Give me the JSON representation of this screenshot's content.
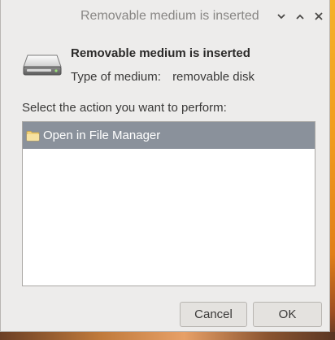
{
  "window": {
    "title": "Removable medium is inserted"
  },
  "header": {
    "heading": "Removable medium is inserted",
    "medium_label": "Type of medium:",
    "medium_value": "removable disk",
    "icon": "drive-removable-icon"
  },
  "actions": {
    "prompt": "Select the action you want to perform:",
    "items": [
      {
        "label": "Open in File Manager",
        "icon": "folder-icon",
        "selected": true
      }
    ],
    "selection_color": "#8a919b"
  },
  "buttons": {
    "cancel_label": "Cancel",
    "ok_label": "OK"
  }
}
